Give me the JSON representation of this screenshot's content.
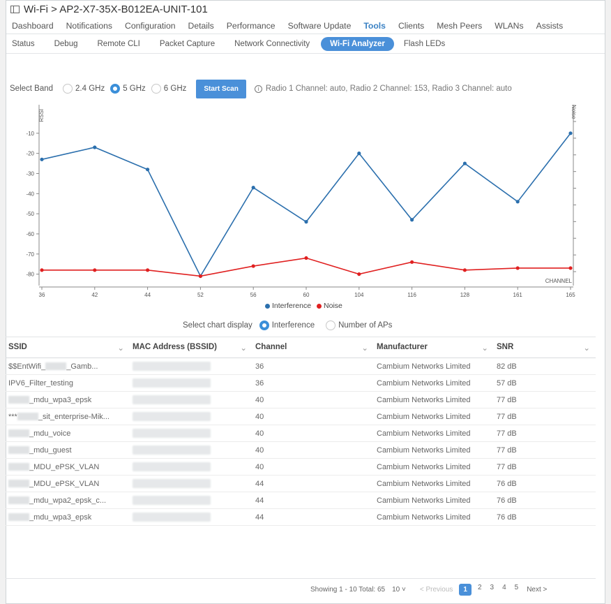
{
  "window": {
    "title": "Wi-Fi > AP2-X7-35X-B012EA-UNIT-101"
  },
  "main_tabs": [
    {
      "label": "Dashboard",
      "active": false
    },
    {
      "label": "Notifications",
      "active": false
    },
    {
      "label": "Configuration",
      "active": false
    },
    {
      "label": "Details",
      "active": false
    },
    {
      "label": "Performance",
      "active": false
    },
    {
      "label": "Software Update",
      "active": false
    },
    {
      "label": "Tools",
      "active": true
    },
    {
      "label": "Clients",
      "active": false
    },
    {
      "label": "Mesh Peers",
      "active": false
    },
    {
      "label": "WLANs",
      "active": false
    },
    {
      "label": "Assists",
      "active": false
    }
  ],
  "sub_tabs": [
    {
      "label": "Status",
      "active": false
    },
    {
      "label": "Debug",
      "active": false
    },
    {
      "label": "Remote CLI",
      "active": false
    },
    {
      "label": "Packet Capture",
      "active": false
    },
    {
      "label": "Network Connectivity",
      "active": false
    },
    {
      "label": "Wi-Fi Analyzer",
      "active": true
    },
    {
      "label": "Flash LEDs",
      "active": false
    }
  ],
  "controls": {
    "band_label": "Select Band",
    "bands": [
      {
        "label": "2.4 GHz",
        "selected": false
      },
      {
        "label": "5 GHz",
        "selected": true
      },
      {
        "label": "6 GHz",
        "selected": false
      }
    ],
    "scan_button": "Start Scan",
    "radio_info": "Radio 1 Channel: auto, Radio 2 Channel: 153, Radio 3 Channel: auto"
  },
  "chart_data": {
    "type": "line",
    "x": [
      36,
      42,
      44,
      52,
      56,
      60,
      104,
      116,
      128,
      161,
      165
    ],
    "x_tick_labels": [
      "36",
      "42",
      "44",
      "52",
      "56",
      "60",
      "104",
      "116",
      "128",
      "161",
      "165"
    ],
    "series": [
      {
        "name": "Interference",
        "color": "#2b6fad",
        "values": [
          -23,
          -17,
          -28,
          -81,
          -37,
          -54,
          -20,
          -53,
          -25,
          -44,
          -10
        ]
      },
      {
        "name": "Noise",
        "color": "#e02020",
        "values": [
          -78,
          -78,
          -78,
          -81,
          -76,
          -72,
          -80,
          -74,
          -78,
          -77,
          -77
        ]
      }
    ],
    "ylabel_left": "RSSI",
    "ylabel_right": "Noise",
    "xlabel": "CHANNEL",
    "ylim_left": [
      -85,
      0
    ],
    "yticks_left": [
      -10,
      -20,
      -30,
      -40,
      -50,
      -60,
      -70,
      -80
    ],
    "yticks_right": [
      -10,
      -20,
      -30,
      -40,
      -50,
      -60,
      -70,
      -80,
      -90,
      -100
    ],
    "grid": false,
    "legend_position": "bottom"
  },
  "chart_display": {
    "label": "Select chart display",
    "options": [
      {
        "label": "Interference",
        "selected": true
      },
      {
        "label": "Number of APs",
        "selected": false
      }
    ]
  },
  "table": {
    "columns": [
      "SSID",
      "MAC Address (BSSID)",
      "Channel",
      "Manufacturer",
      "SNR"
    ],
    "rows": [
      {
        "ssid_pre": "$$EntWifi_",
        "ssid_post": "_Gamb...",
        "channel": "36",
        "manufacturer": "Cambium Networks Limited",
        "snr": "82 dB"
      },
      {
        "ssid_pre": "IPV6_Filter_testing",
        "ssid_post": "",
        "channel": "36",
        "manufacturer": "Cambium Networks Limited",
        "snr": "57 dB"
      },
      {
        "ssid_pre": "",
        "ssid_post": "_mdu_wpa3_epsk",
        "channel": "40",
        "manufacturer": "Cambium Networks Limited",
        "snr": "77 dB"
      },
      {
        "ssid_pre": "***",
        "ssid_post": "_sit_enterprise-Mik...",
        "channel": "40",
        "manufacturer": "Cambium Networks Limited",
        "snr": "77 dB"
      },
      {
        "ssid_pre": "",
        "ssid_post": "_mdu_voice",
        "channel": "40",
        "manufacturer": "Cambium Networks Limited",
        "snr": "77 dB"
      },
      {
        "ssid_pre": "",
        "ssid_post": "_mdu_guest",
        "channel": "40",
        "manufacturer": "Cambium Networks Limited",
        "snr": "77 dB"
      },
      {
        "ssid_pre": "",
        "ssid_post": "_MDU_ePSK_VLAN",
        "channel": "40",
        "manufacturer": "Cambium Networks Limited",
        "snr": "77 dB"
      },
      {
        "ssid_pre": "",
        "ssid_post": "_MDU_ePSK_VLAN",
        "channel": "44",
        "manufacturer": "Cambium Networks Limited",
        "snr": "76 dB"
      },
      {
        "ssid_pre": "",
        "ssid_post": "_mdu_wpa2_epsk_c...",
        "channel": "44",
        "manufacturer": "Cambium Networks Limited",
        "snr": "76 dB"
      },
      {
        "ssid_pre": "",
        "ssid_post": "_mdu_wpa3_epsk",
        "channel": "44",
        "manufacturer": "Cambium Networks Limited",
        "snr": "76 dB"
      }
    ]
  },
  "pagination": {
    "summary": "Showing 1 - 10  Total: 65",
    "page_size": "10 ˅",
    "previous": "< Previous",
    "pages": [
      "1",
      "2",
      "3",
      "4",
      "5"
    ],
    "current": "1",
    "next": "Next >"
  }
}
